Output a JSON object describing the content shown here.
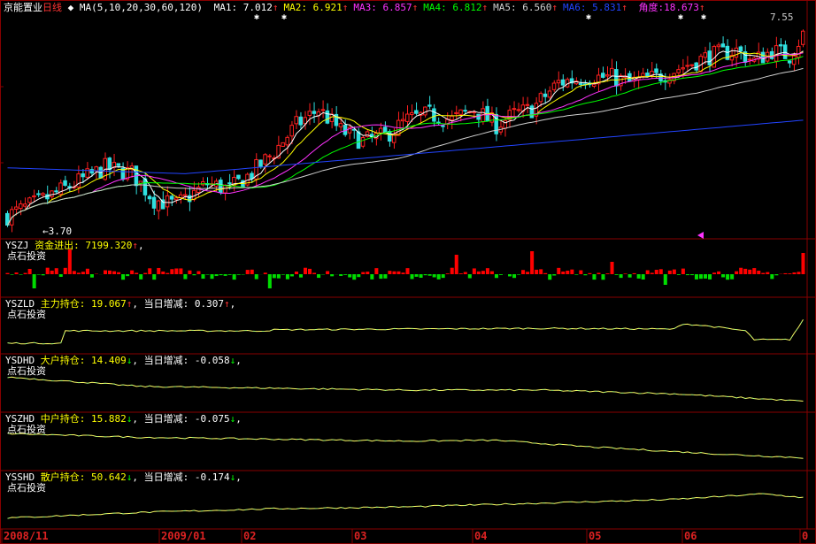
{
  "header": {
    "stock_name": "京能置业",
    "period": "日线",
    "ma_spec": "MA(5,10,20,30,60,120)",
    "ma": [
      {
        "label": "MA1:",
        "value": "7.012",
        "arrow": "↑",
        "color": "#ffffff"
      },
      {
        "label": "MA2:",
        "value": "6.921",
        "arrow": "↑",
        "color": "#ffff00"
      },
      {
        "label": "MA3:",
        "value": "6.857",
        "arrow": "↑",
        "color": "#ff33ff"
      },
      {
        "label": "MA4:",
        "value": "6.812",
        "arrow": "↑",
        "color": "#00ff00"
      },
      {
        "label": "MA5:",
        "value": "6.560",
        "arrow": "↑",
        "color": "#d0d0d0"
      },
      {
        "label": "MA6:",
        "value": "5.831",
        "arrow": "↑",
        "color": "#2244ff"
      }
    ],
    "angle_label": "角度:",
    "angle_value": "18.673",
    "angle_arrow": "↑",
    "angle_color": "#ff33ff"
  },
  "price_labels": {
    "high": "7.55",
    "low": "3.70"
  },
  "panels": [
    {
      "code": "YSZJ",
      "name": "资金进出:",
      "value": "7199.320",
      "arrow": "↑",
      "extra_label": "",
      "extra_value": "",
      "extra_arrow": "",
      "brand": "点石投资"
    },
    {
      "code": "YSZLD",
      "name": "主力持仓:",
      "value": "19.067",
      "arrow": "↑",
      "extra_label": "当日增减:",
      "extra_value": "0.307",
      "extra_arrow": "↑",
      "brand": "点石投资"
    },
    {
      "code": "YSDHD",
      "name": "大户持仓:",
      "value": "14.409",
      "arrow": "↓",
      "extra_label": "当日增减:",
      "extra_value": "-0.058",
      "extra_arrow": "↓",
      "brand": "点石投资"
    },
    {
      "code": "YSZHD",
      "name": "中户持仓:",
      "value": "15.882",
      "arrow": "↓",
      "extra_label": "当日增减:",
      "extra_value": "-0.075",
      "extra_arrow": "↓",
      "brand": "点石投资"
    },
    {
      "code": "YSSHD",
      "name": "散户持仓:",
      "value": "50.642",
      "arrow": "↓",
      "extra_label": "当日增减:",
      "extra_value": "-0.174",
      "extra_arrow": "↓",
      "brand": "点石投资"
    }
  ],
  "date_axis": [
    "2008/11",
    "2009/01",
    "02",
    "03",
    "04",
    "05",
    "06",
    "0"
  ],
  "colors": {
    "up": "#ff2020",
    "down": "#30e0e0",
    "grid": "#880000",
    "vol_up": "#ff0000",
    "vol_down": "#00dd00",
    "text": "#ffffff"
  },
  "chart_data": {
    "type": "candlestick",
    "bars": 180,
    "price_range": [
      3.7,
      7.55
    ],
    "price_anchors": [
      [
        0,
        4.0
      ],
      [
        8,
        4.3
      ],
      [
        15,
        4.6
      ],
      [
        22,
        4.9
      ],
      [
        28,
        4.8
      ],
      [
        33,
        4.3
      ],
      [
        38,
        4.2
      ],
      [
        45,
        4.6
      ],
      [
        50,
        4.5
      ],
      [
        55,
        4.8
      ],
      [
        60,
        5.2
      ],
      [
        65,
        5.7
      ],
      [
        70,
        6.0
      ],
      [
        75,
        5.6
      ],
      [
        80,
        5.4
      ],
      [
        85,
        5.5
      ],
      [
        90,
        5.8
      ],
      [
        95,
        5.9
      ],
      [
        100,
        5.8
      ],
      [
        105,
        6.0
      ],
      [
        110,
        5.7
      ],
      [
        114,
        5.9
      ],
      [
        118,
        6.0
      ],
      [
        124,
        6.5
      ],
      [
        130,
        6.6
      ],
      [
        136,
        6.6
      ],
      [
        140,
        6.5
      ],
      [
        146,
        6.6
      ],
      [
        152,
        6.8
      ],
      [
        158,
        7.0
      ],
      [
        164,
        7.1
      ],
      [
        168,
        6.9
      ],
      [
        172,
        7.1
      ],
      [
        176,
        7.0
      ],
      [
        179,
        7.4
      ]
    ],
    "yszj_range": [
      -1,
      1
    ],
    "zhuli_anchors": [
      [
        0,
        0.2
      ],
      [
        12,
        0.2
      ],
      [
        13,
        0.55
      ],
      [
        58,
        0.55
      ],
      [
        60,
        0.58
      ],
      [
        120,
        0.62
      ],
      [
        150,
        0.6
      ],
      [
        152,
        0.75
      ],
      [
        158,
        0.68
      ],
      [
        166,
        0.55
      ],
      [
        168,
        0.3
      ],
      [
        176,
        0.3
      ],
      [
        179,
        0.85
      ]
    ],
    "dahu_anchors": [
      [
        0,
        0.85
      ],
      [
        30,
        0.6
      ],
      [
        60,
        0.55
      ],
      [
        90,
        0.5
      ],
      [
        120,
        0.5
      ],
      [
        150,
        0.4
      ],
      [
        179,
        0.2
      ]
    ],
    "zhonghu_anchors": [
      [
        0,
        0.9
      ],
      [
        30,
        0.8
      ],
      [
        60,
        0.75
      ],
      [
        90,
        0.7
      ],
      [
        110,
        0.72
      ],
      [
        130,
        0.55
      ],
      [
        160,
        0.35
      ],
      [
        179,
        0.25
      ]
    ],
    "sanhu_anchors": [
      [
        0,
        0.2
      ],
      [
        30,
        0.35
      ],
      [
        60,
        0.45
      ],
      [
        90,
        0.5
      ],
      [
        120,
        0.6
      ],
      [
        150,
        0.7
      ],
      [
        170,
        0.85
      ],
      [
        179,
        0.75
      ]
    ]
  }
}
